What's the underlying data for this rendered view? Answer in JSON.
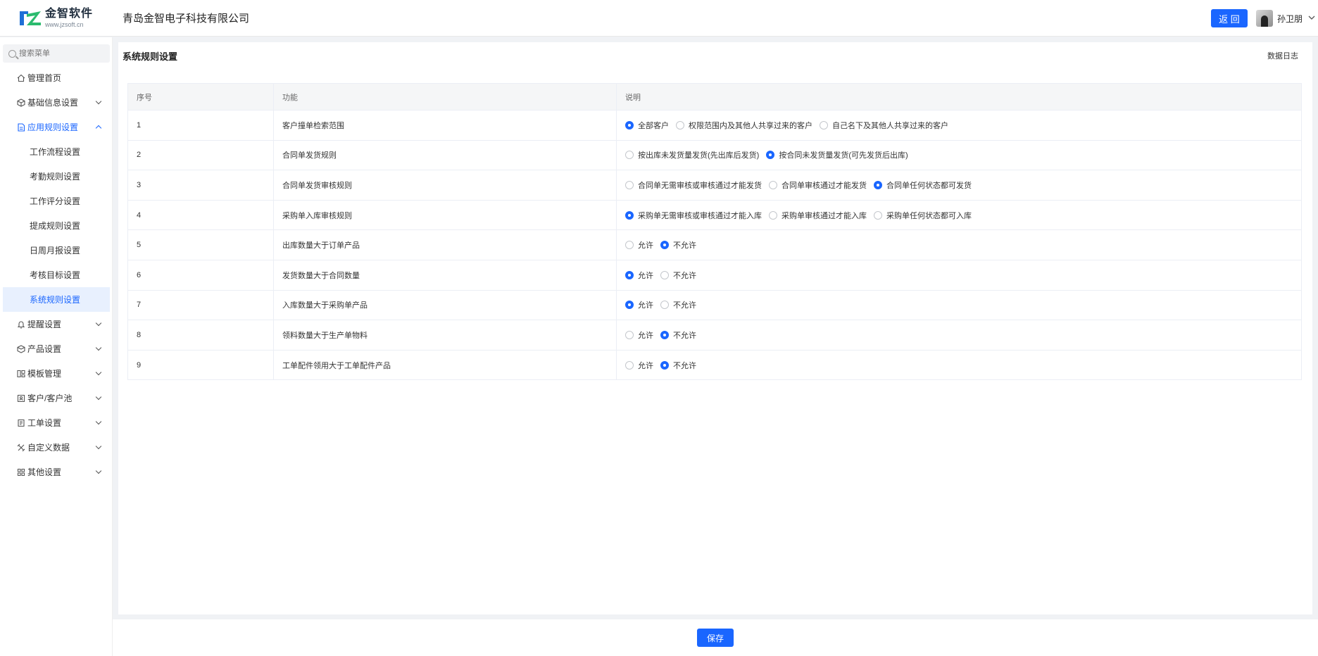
{
  "header": {
    "logo_cn": "金智软件",
    "logo_en": "www.jzsoft.cn",
    "company": "青岛金智电子科技有限公司",
    "back_label": "返 回",
    "username": "孙卫朋"
  },
  "sidebar": {
    "search_placeholder": "搜索菜单",
    "items": [
      {
        "label": "管理首页",
        "icon": "home-icon"
      },
      {
        "label": "基础信息设置",
        "icon": "cube-icon"
      },
      {
        "label": "应用规则设置",
        "icon": "document-icon"
      },
      {
        "label": "提醒设置",
        "icon": "bell-icon"
      },
      {
        "label": "产品设置",
        "icon": "box-icon"
      },
      {
        "label": "模板管理",
        "icon": "template-icon"
      },
      {
        "label": "客户/客户池",
        "icon": "customer-icon"
      },
      {
        "label": "工单设置",
        "icon": "workorder-icon"
      },
      {
        "label": "自定义数据",
        "icon": "tools-icon"
      },
      {
        "label": "其他设置",
        "icon": "grid-icon"
      }
    ],
    "subitems": [
      "工作流程设置",
      "考勤规则设置",
      "工作评分设置",
      "提成规则设置",
      "日周月报设置",
      "考核目标设置",
      "系统规则设置"
    ]
  },
  "main": {
    "title": "系统规则设置",
    "data_log": "数据日志",
    "columns": [
      "序号",
      "功能",
      "说明"
    ],
    "rows": [
      {
        "idx": "1",
        "func": "客户撞单检索范围",
        "options": [
          "全部客户",
          "权限范围内及其他人共享过来的客户",
          "自己名下及其他人共享过来的客户"
        ],
        "selected": 0
      },
      {
        "idx": "2",
        "func": "合同单发货规则",
        "options": [
          "按出库未发货量发货(先出库后发货)",
          "按合同未发货量发货(可先发货后出库)"
        ],
        "selected": 1
      },
      {
        "idx": "3",
        "func": "合同单发货审核规则",
        "options": [
          "合同单无需审核或审核通过才能发货",
          "合同单审核通过才能发货",
          "合同单任何状态都可发货"
        ],
        "selected": 2
      },
      {
        "idx": "4",
        "func": "采购单入库审核规则",
        "options": [
          "采购单无需审核或审核通过才能入库",
          "采购单审核通过才能入库",
          "采购单任何状态都可入库"
        ],
        "selected": 0
      },
      {
        "idx": "5",
        "func": "出库数量大于订单产品",
        "options": [
          "允许",
          "不允许"
        ],
        "selected": 1
      },
      {
        "idx": "6",
        "func": "发货数量大于合同数量",
        "options": [
          "允许",
          "不允许"
        ],
        "selected": 0
      },
      {
        "idx": "7",
        "func": "入库数量大于采购单产品",
        "options": [
          "允许",
          "不允许"
        ],
        "selected": 0
      },
      {
        "idx": "8",
        "func": "领料数量大于生产单物料",
        "options": [
          "允许",
          "不允许"
        ],
        "selected": 1
      },
      {
        "idx": "9",
        "func": "工单配件领用大于工单配件产品",
        "options": [
          "允许",
          "不允许"
        ],
        "selected": 1
      }
    ]
  },
  "footer": {
    "save_label": "保存"
  },
  "colors": {
    "accent": "#1a66ff"
  }
}
